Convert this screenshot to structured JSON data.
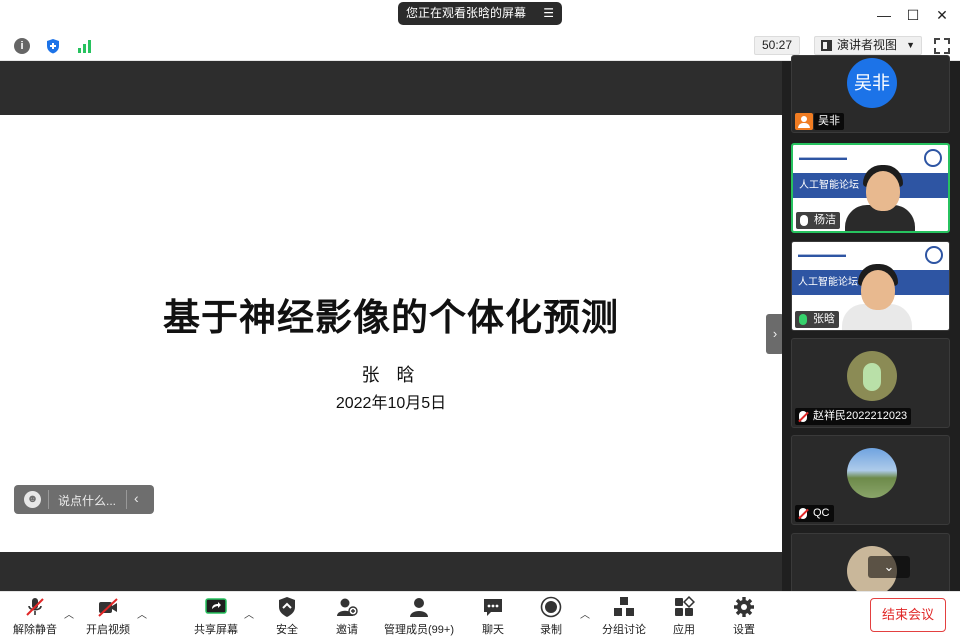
{
  "titlebar": {
    "banner": "您正在观看张晗的屏幕",
    "banner_menu_icon": "list-menu-icon",
    "minimize_icon": "minimize-icon",
    "maximize_icon": "maximize-icon",
    "close_icon": "close-icon"
  },
  "toprow": {
    "info_icon": "info-icon",
    "encryption_icon": "shield-icon",
    "signal_icon": "signal-bars-icon",
    "timer": "50:27",
    "view_selector": "演讲者视图",
    "fullscreen_icon": "fullscreen-icon"
  },
  "slide": {
    "title": "基于神经影像的个体化预测",
    "author": "张 晗",
    "date": "2022年10月5日"
  },
  "chat": {
    "placeholder": "说点什么..."
  },
  "gallery": {
    "participants": [
      {
        "name": "吴非",
        "avatar_text": "吴非",
        "mic": "none"
      },
      {
        "name": "杨洁",
        "banner": "人工智能论坛",
        "mic": "on",
        "active": true
      },
      {
        "name": "张晗",
        "banner": "人工智能论坛",
        "mic": "speaking"
      },
      {
        "name": "赵祥民2022212023",
        "mic": "muted"
      },
      {
        "name": "QC",
        "mic": "muted"
      }
    ]
  },
  "toolbar": {
    "unmute": "解除静音",
    "start_video": "开启视频",
    "share_screen": "共享屏幕",
    "security": "安全",
    "invite": "邀请",
    "participants": "管理成员(99+)",
    "chat": "聊天",
    "record": "录制",
    "breakout": "分组讨论",
    "apps": "应用",
    "settings": "设置",
    "end_meeting": "结束会议"
  },
  "colors": {
    "accent_green": "#27c25f",
    "end_red": "#e02727",
    "avatar_blue": "#1c73e8",
    "banner_blue": "#2e55a3"
  }
}
